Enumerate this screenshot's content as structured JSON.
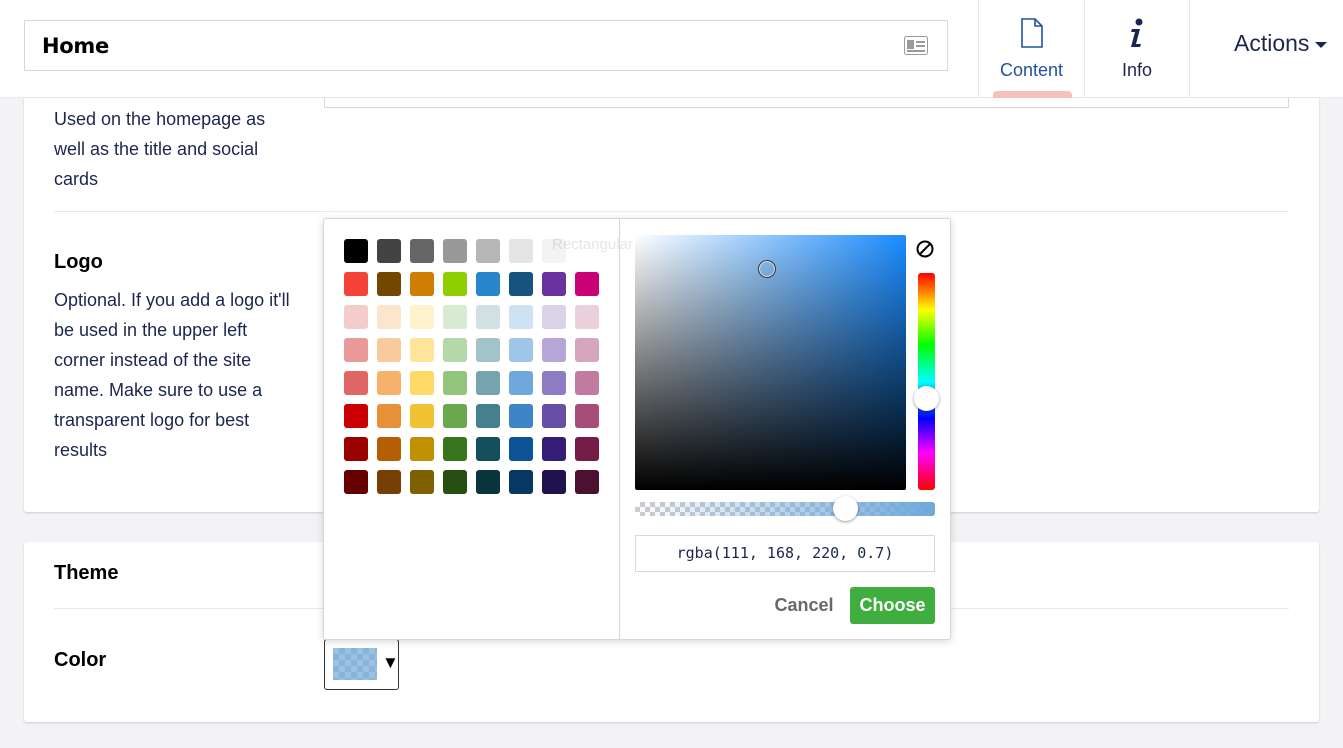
{
  "header": {
    "name": "Home",
    "tabs": [
      {
        "label": "Content",
        "icon": "document-icon",
        "active": true
      },
      {
        "label": "Info",
        "icon": "info-icon",
        "active": false
      }
    ],
    "actions_label": "Actions"
  },
  "sections": {
    "site_name_description": "Used on the homepage as well as the title and social cards",
    "logo": {
      "label": "Logo",
      "description": "Optional. If you add a logo it'll be used in the upper left corner instead of the site name. Make sure to use a transparent logo for best results"
    },
    "theme": {
      "heading": "Theme",
      "color_label": "Color",
      "color_value": "rgba(111, 168, 220, 0.7)"
    }
  },
  "color_picker": {
    "palette": [
      [
        "#000000",
        "#434343",
        "#666666",
        "#999999",
        "#b7b7b7",
        "#e4e4e4",
        "#f3f3f3",
        "#ffffff"
      ],
      [
        "#f44336",
        "#744700",
        "#ce7e00",
        "#8fce00",
        "#2986cc",
        "#16537e",
        "#6a329f",
        "#c90076"
      ],
      [
        "#f4cccc",
        "#fce5cd",
        "#fff2cc",
        "#d9ead3",
        "#d0e0e3",
        "#cfe2f3",
        "#d9d2e9",
        "#ead1dc"
      ],
      [
        "#ea9999",
        "#f9cb9c",
        "#ffe599",
        "#b6d7a8",
        "#a2c4c9",
        "#9fc5e8",
        "#b4a7d6",
        "#d5a6bd"
      ],
      [
        "#e06666",
        "#f6b26b",
        "#ffd966",
        "#93c47d",
        "#76a5af",
        "#6fa8dc",
        "#8e7cc3",
        "#c27ba0"
      ],
      [
        "#cc0000",
        "#e69138",
        "#f1c232",
        "#6aa84f",
        "#45818e",
        "#3d85c6",
        "#674ea7",
        "#a64d79"
      ],
      [
        "#990000",
        "#b45f06",
        "#bf9000",
        "#38761d",
        "#134f5c",
        "#0b5394",
        "#351c75",
        "#741b47"
      ],
      [
        "#660000",
        "#783f04",
        "#7f6000",
        "#274e13",
        "#0c343d",
        "#073763",
        "#20124d",
        "#4c1130"
      ]
    ],
    "ghost_text": "Rectangular Snip",
    "value": "rgba(111, 168, 220, 0.7)",
    "alpha": 0.7,
    "cancel_label": "Cancel",
    "choose_label": "Choose",
    "clear_icon": "no-color-icon"
  }
}
